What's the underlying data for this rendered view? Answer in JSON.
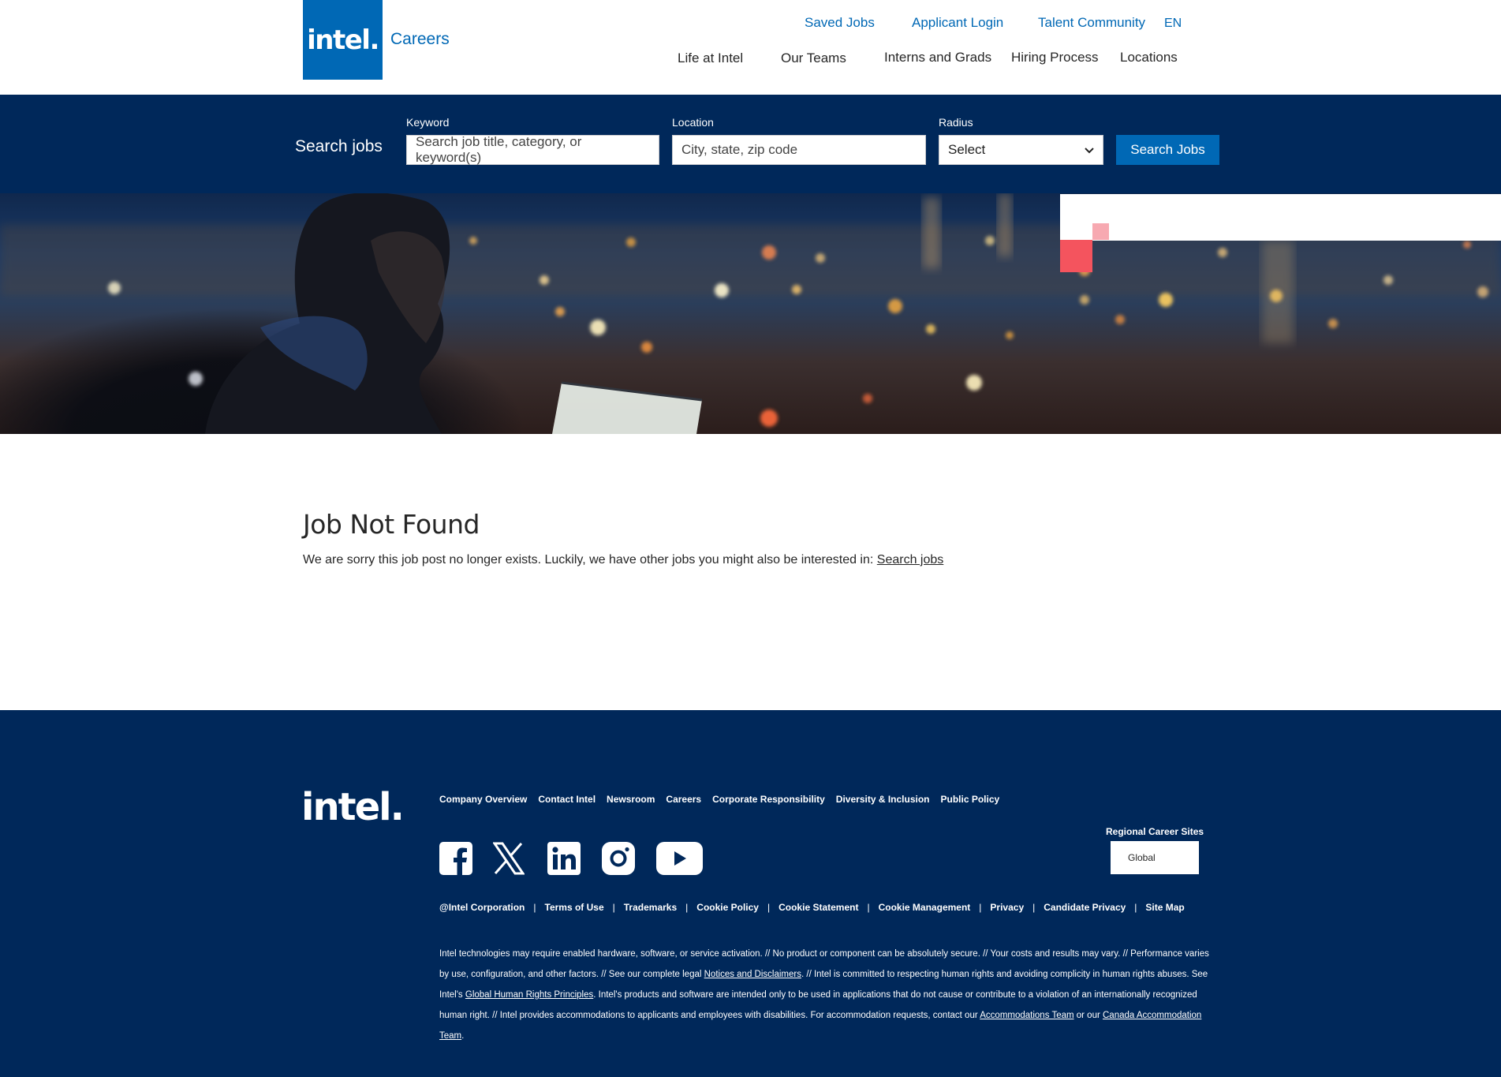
{
  "header": {
    "logo": "intel.",
    "careers": "Careers",
    "top_links": {
      "saved_jobs": "Saved Jobs",
      "applicant_login": "Applicant Login",
      "talent_community": "Talent Community",
      "language": "EN"
    },
    "main_nav": {
      "life_at_intel": "Life at Intel",
      "our_teams": "Our Teams",
      "interns_and_grads": "Interns and Grads",
      "hiring_process": "Hiring Process",
      "locations": "Locations"
    }
  },
  "search": {
    "title": "Search jobs",
    "keyword_label": "Keyword",
    "keyword_placeholder": "Search job title, category, or keyword(s)",
    "location_label": "Location",
    "location_placeholder": "City, state, zip code",
    "radius_label": "Radius",
    "radius_value": "Select",
    "button": "Search Jobs"
  },
  "content": {
    "title": "Job Not Found",
    "message": "We are sorry this job post no longer exists. Luckily, we have other jobs you might also be interested in: ",
    "link": "Search jobs"
  },
  "footer": {
    "logo": "intel.",
    "links": [
      "Company Overview",
      "Contact Intel",
      "Newsroom",
      "Careers",
      "Corporate Responsibility",
      "Diversity & Inclusion",
      "Public Policy"
    ],
    "social_icons": [
      "facebook-icon",
      "x-icon",
      "linkedin-icon",
      "instagram-icon",
      "youtube-icon"
    ],
    "regional_label": "Regional Career Sites",
    "regional_value": "Global",
    "legal": [
      "@Intel Corporation",
      "Terms of Use",
      "Trademarks",
      "Cookie Policy",
      "Cookie Statement",
      "Cookie Management",
      "Privacy",
      "Candidate Privacy",
      "Site Map"
    ],
    "disclaimer": {
      "part1": "Intel technologies may require enabled hardware, software, or service activation. // No product or component can be absolutely secure. // Your costs and results may vary. // Performance varies by use, configuration, and other factors. // See our complete legal ",
      "link1": "Notices and Disclaimers",
      "part2": ". // Intel is committed to respecting human rights and avoiding complicity in human rights abuses. See Intel's ",
      "link2": "Global Human Rights Principles",
      "part3": ". Intel's products and software are intended only to be used in applications that do not cause or contribute to a violation of an internationally recognized human right. // Intel provides accommodations to applicants and employees with disabilities. For accommodation requests, contact our ",
      "link3": "Accommodations Team",
      "part4": " or our ",
      "link4": "Canada Accommodation Team",
      "part5": "."
    }
  },
  "colors": {
    "brand_blue": "#0068b5",
    "navy": "#00285a",
    "accent_red": "#f4545e",
    "accent_pink": "#f7a9b1"
  }
}
